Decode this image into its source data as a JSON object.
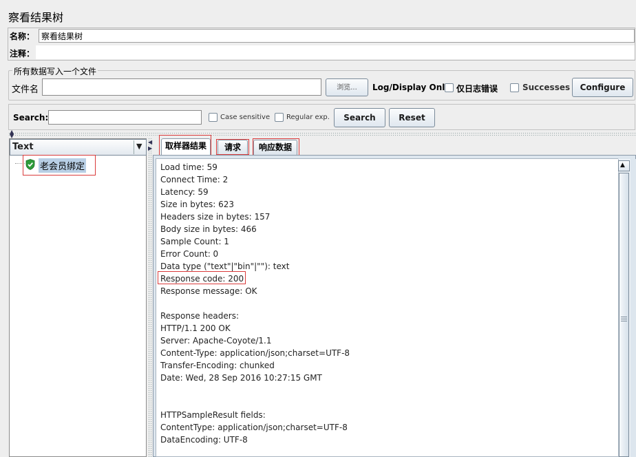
{
  "panel": {
    "title": "察看结果树"
  },
  "name_field": {
    "label": "名称：",
    "value": "察看结果树"
  },
  "comment_field": {
    "label": "注释：",
    "value": ""
  },
  "file_group": {
    "title": "所有数据写入一个文件",
    "filename_label": "文件名",
    "filename_value": "",
    "browse_label": "浏览...",
    "log_display_label": "Log/Display Only:",
    "errors_label": "仅日志错误",
    "successes_label": "Successes",
    "configure_label": "Configure"
  },
  "search": {
    "label": "Search:",
    "value": "",
    "case_sensitive_label": "Case sensitive",
    "regex_label": "Regular exp.",
    "search_button": "Search",
    "reset_button": "Reset"
  },
  "renderer": {
    "selected": "Text",
    "arrow": "▼"
  },
  "tree": {
    "items": [
      {
        "label": "老会员绑定",
        "status": "success"
      }
    ]
  },
  "tabs": [
    {
      "label": "取样器结果",
      "active": true
    },
    {
      "label": "请求",
      "active": false
    },
    {
      "label": "响应数据",
      "active": false
    }
  ],
  "result": {
    "lines": [
      "Load time: 59",
      "Connect Time: 2",
      "Latency: 59",
      "Size in bytes: 623",
      "Headers size in bytes: 157",
      "Body size in bytes: 466",
      "Sample Count: 1",
      "Error Count: 0",
      "Data type (\"text\"|\"bin\"|\"\"): text",
      "Response code: 200",
      "Response message: OK",
      "",
      "Response headers:",
      "HTTP/1.1 200 OK",
      "Server: Apache-Coyote/1.1",
      "Content-Type: application/json;charset=UTF-8",
      "Transfer-Encoding: chunked",
      "Date: Wed, 28 Sep 2016 10:27:15 GMT",
      "",
      "",
      "HTTPSampleResult fields:",
      "ContentType: application/json;charset=UTF-8",
      "DataEncoding: UTF-8"
    ]
  },
  "colors": {
    "highlight": "#d93a3a",
    "selection": "#b8cfe5",
    "success_icon": "#2e9b3a"
  },
  "icons": {
    "tree_status": "shield-check-icon",
    "scroll_up": "arrow-up-icon"
  }
}
